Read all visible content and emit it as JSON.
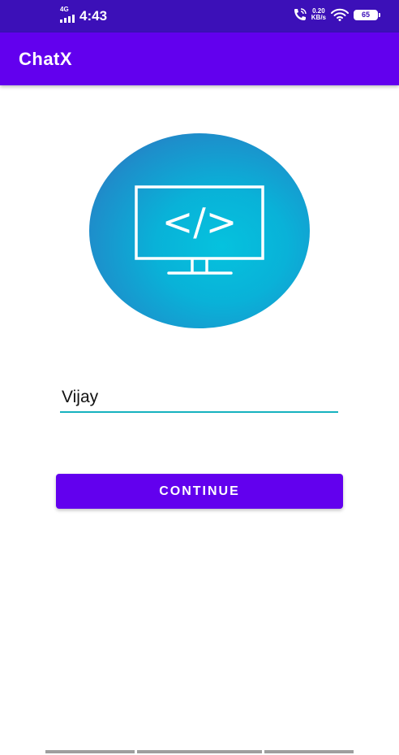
{
  "status_bar": {
    "network_type": "4G",
    "time": "4:43",
    "data_speed_value": "0.20",
    "data_speed_unit": "KB/s",
    "battery_level": "65",
    "icons": [
      "signal-bars-icon",
      "volte-call-icon",
      "wifi-icon",
      "battery-icon"
    ]
  },
  "app_bar": {
    "title": "ChatX",
    "color": "#6200ee"
  },
  "logo": {
    "icon": "code-monitor-icon",
    "code_glyph": "</>"
  },
  "name_input": {
    "value": "Vijay",
    "underline_color": "#16b2bf"
  },
  "continue_button": {
    "label": "CONTINUE",
    "color": "#6200ee"
  },
  "nav_bar": {
    "icons": [
      "nav-recents-icon",
      "nav-home-icon",
      "nav-back-icon"
    ]
  }
}
